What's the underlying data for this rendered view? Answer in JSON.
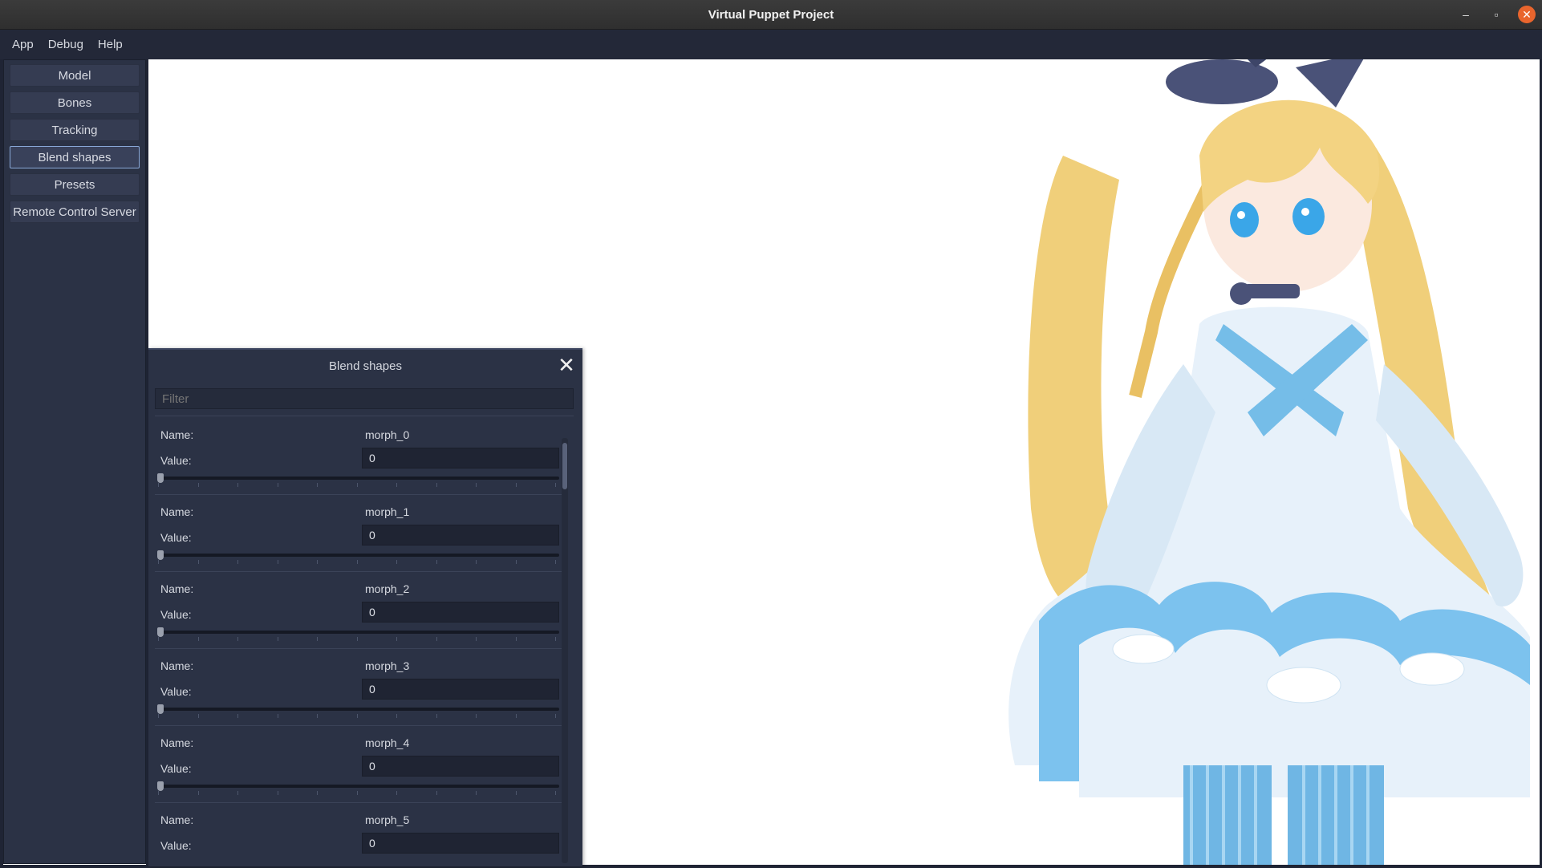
{
  "window": {
    "title": "Virtual Puppet Project",
    "minimize": "–",
    "maximize": "▫",
    "close": "✕"
  },
  "menu": [
    "App",
    "Debug",
    "Help"
  ],
  "sidebar": {
    "items": [
      {
        "label": "Model"
      },
      {
        "label": "Bones"
      },
      {
        "label": "Tracking"
      },
      {
        "label": "Blend shapes",
        "active": true
      },
      {
        "label": "Presets"
      },
      {
        "label": "Remote Control Server"
      }
    ]
  },
  "blend_panel": {
    "title": "Blend shapes",
    "close_glyph": "✕",
    "filter_placeholder": "Filter",
    "name_label": "Name:",
    "value_label": "Value:",
    "entries": [
      {
        "name": "morph_0",
        "value": "0",
        "slider": 0
      },
      {
        "name": "morph_1",
        "value": "0",
        "slider": 0
      },
      {
        "name": "morph_2",
        "value": "0",
        "slider": 0
      },
      {
        "name": "morph_3",
        "value": "0",
        "slider": 0
      },
      {
        "name": "morph_4",
        "value": "0",
        "slider": 0
      },
      {
        "name": "morph_5",
        "value": "0",
        "slider": 0
      }
    ]
  },
  "colors": {
    "accent": "#8aa9d8",
    "panel_bg": "#2b3245",
    "menubar_bg": "#232838",
    "close_btn": "#e9652d"
  }
}
